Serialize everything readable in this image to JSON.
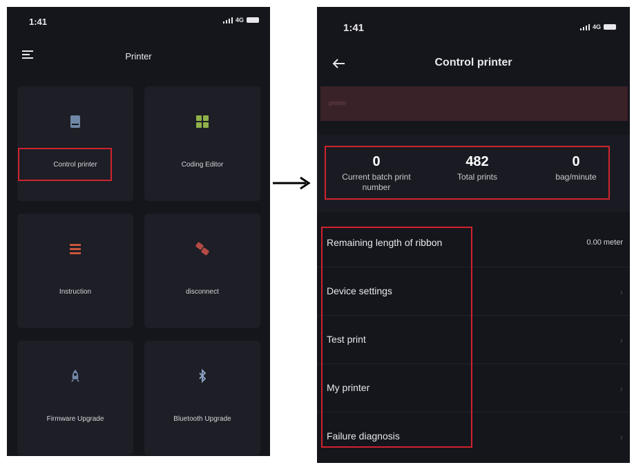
{
  "left_screen": {
    "status": {
      "time": "1:41",
      "network": "4G"
    },
    "nav": {
      "title": "Printer"
    },
    "cards": [
      {
        "label": "Control printer",
        "icon": "printer-icon",
        "color": "#6f86a6"
      },
      {
        "label": "Coding Editor",
        "icon": "grid-icon",
        "color": "#8fb14a"
      },
      {
        "label": "Instruction",
        "icon": "list-icon",
        "color": "#c8553a"
      },
      {
        "label": "disconnect",
        "icon": "disconnect-icon",
        "color": "#b34a44"
      },
      {
        "label": "Firmware Upgrade",
        "icon": "rocket-icon",
        "color": "#6f86a6"
      },
      {
        "label": "Bluetooth Upgrade",
        "icon": "bluetooth-icon",
        "color": "#6f86a6"
      }
    ]
  },
  "right_screen": {
    "status": {
      "time": "1:41",
      "network": "4G"
    },
    "nav": {
      "title": "Control printer",
      "back_icon": "arrow-left-icon"
    },
    "banner": {
      "text": "printer"
    },
    "stats": [
      {
        "value": "0",
        "label": "Current batch print number"
      },
      {
        "value": "482",
        "label": "Total prints"
      },
      {
        "value": "0",
        "label": "bag/minute"
      }
    ],
    "rows": [
      {
        "label": "Remaining length of ribbon",
        "value": "0.00 meter"
      },
      {
        "label": "Device settings"
      },
      {
        "label": "Test print"
      },
      {
        "label": "My printer"
      },
      {
        "label": "Failure diagnosis"
      }
    ]
  },
  "colors": {
    "background": "#15161c",
    "card": "#1d1e26",
    "highlight": "#d0232e"
  }
}
